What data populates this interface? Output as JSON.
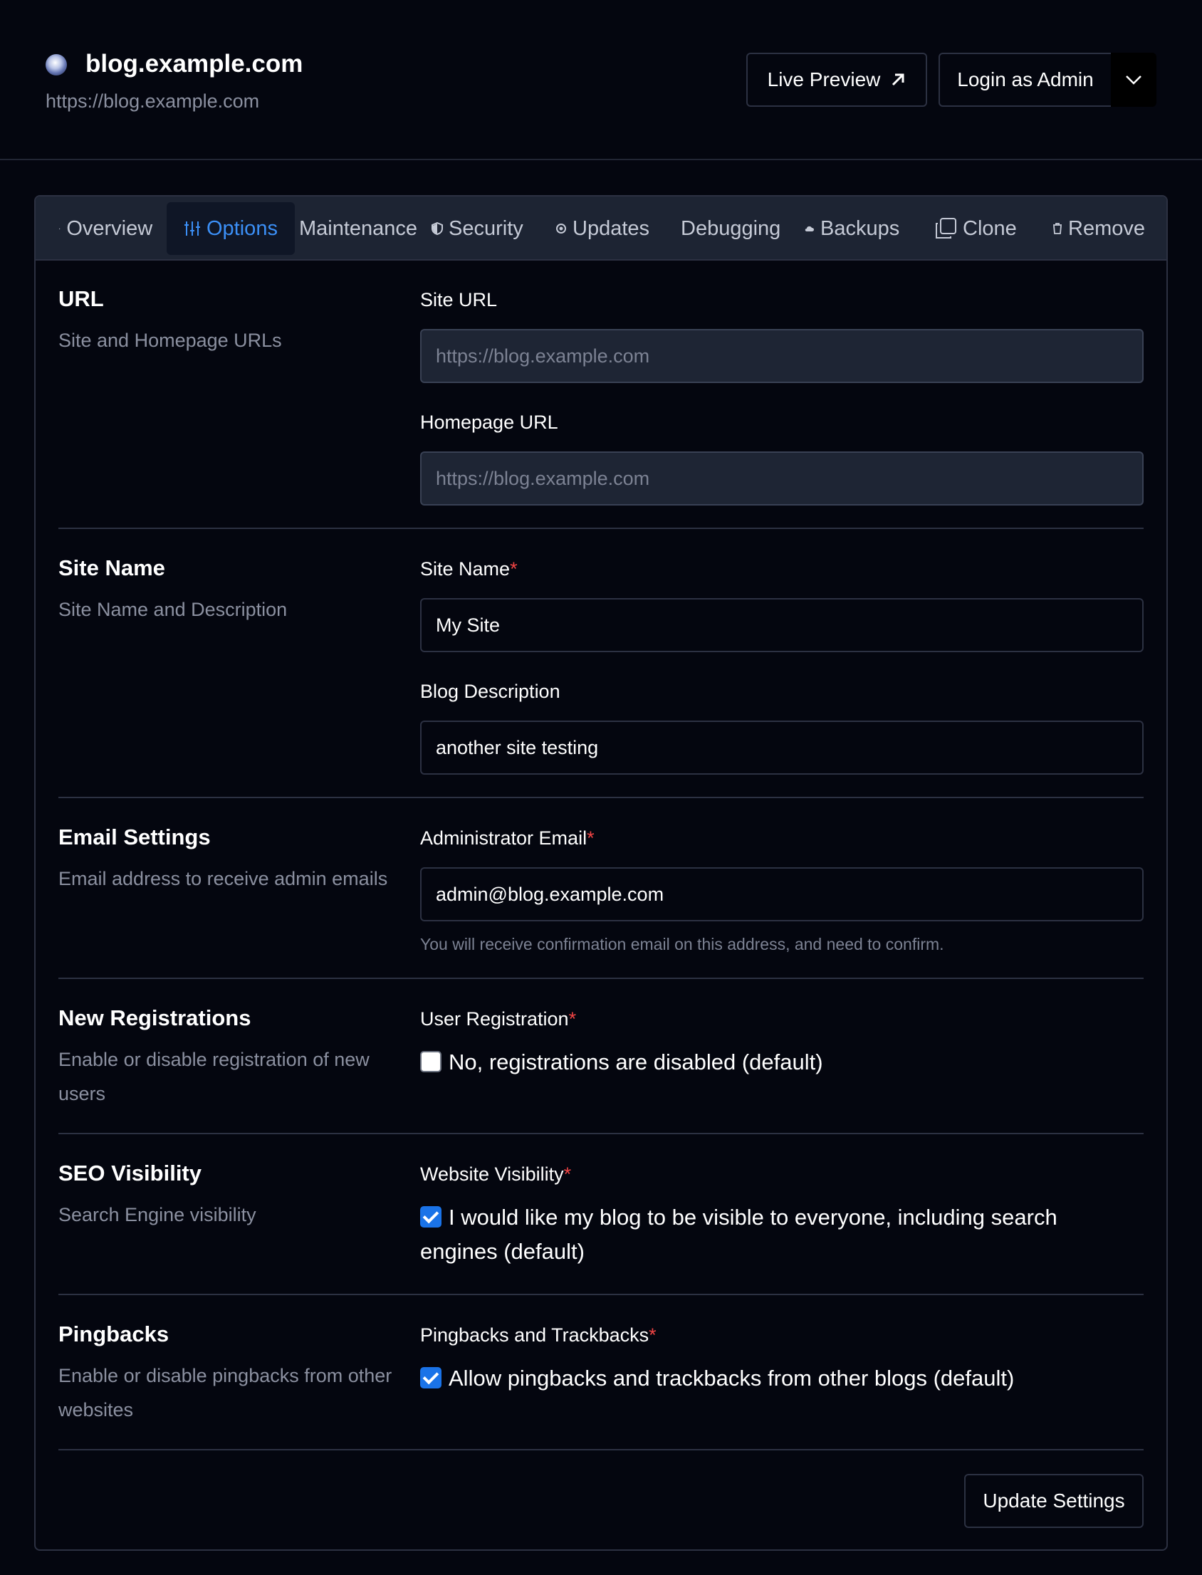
{
  "header": {
    "title": "blog.example.com",
    "url": "https://blog.example.com",
    "live_preview": "Live Preview",
    "login_admin": "Login as Admin"
  },
  "tabs": [
    {
      "label": "Overview",
      "icon": "dot-icon"
    },
    {
      "label": "Options",
      "icon": "sliders-icon"
    },
    {
      "label": "Maintenance",
      "icon": ""
    },
    {
      "label": "Security",
      "icon": "shield-icon"
    },
    {
      "label": "Updates",
      "icon": "target-icon"
    },
    {
      "label": "Debugging",
      "icon": ""
    },
    {
      "label": "Backups",
      "icon": "cloud-icon"
    },
    {
      "label": "Clone",
      "icon": "copy-icon"
    },
    {
      "label": "Remove",
      "icon": "trash-icon"
    }
  ],
  "active_tab": "Options",
  "sections": {
    "url": {
      "title": "URL",
      "desc": "Site and Homepage URLs",
      "site_url_label": "Site URL",
      "site_url_placeholder": "https://blog.example.com",
      "home_url_label": "Homepage URL",
      "home_url_placeholder": "https://blog.example.com"
    },
    "site_name": {
      "title": "Site Name",
      "desc": "Site Name and Description",
      "name_label": "Site Name",
      "name_value": "My Site",
      "desc_label": "Blog Description",
      "desc_value": "another site testing"
    },
    "email": {
      "title": "Email Settings",
      "desc": "Email address to receive admin emails",
      "label": "Administrator Email",
      "value": "admin@blog.example.com",
      "help": "You will receive confirmation email on this address, and need to confirm."
    },
    "registrations": {
      "title": "New Registrations",
      "desc": "Enable or disable registration of new users",
      "label": "User Registration",
      "option": "No, registrations are disabled (default)",
      "checked": false
    },
    "seo": {
      "title": "SEO Visibility",
      "desc": "Search Engine visibility",
      "label": "Website Visibility",
      "option": "I would like my blog to be visible to everyone, including search engines (default)",
      "checked": true
    },
    "pingbacks": {
      "title": "Pingbacks",
      "desc": "Enable or disable pingbacks from other websites",
      "label": "Pingbacks and Trackbacks",
      "option": "Allow pingbacks and trackbacks from other blogs (default)",
      "checked": true
    }
  },
  "required_marker": "*",
  "update_button": "Update Settings",
  "colors": {
    "background": "#04060f",
    "accent": "#3b8ff6",
    "required": "#ef4444",
    "checkbox": "#1a73e8"
  }
}
